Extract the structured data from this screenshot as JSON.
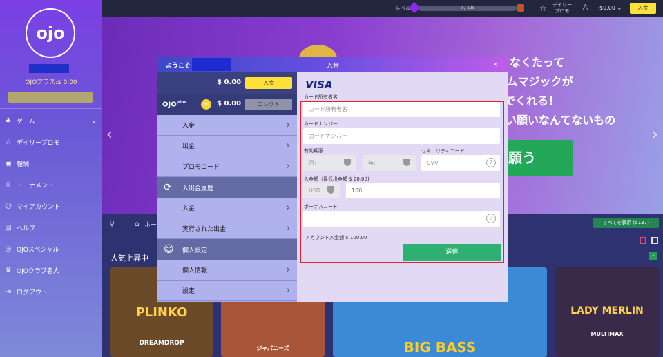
{
  "sidebar": {
    "logo": "ojo",
    "ojo_plus": "OJOプラス:$ 0.00",
    "button_label": "",
    "items": [
      {
        "label": "ゲーム",
        "icon": "game-icon",
        "chevron": "⌄"
      },
      {
        "label": "デイリープロモ",
        "icon": "star-icon"
      },
      {
        "label": "報酬",
        "icon": "reward-icon"
      },
      {
        "label": "トーナメント",
        "icon": "trophy-icon"
      },
      {
        "label": "マイアカウント",
        "icon": "user-icon"
      },
      {
        "label": "ヘルプ",
        "icon": "help-icon"
      },
      {
        "label": "OJOスペシャル",
        "icon": "ojo-special-icon"
      },
      {
        "label": "OJOクラブ名人",
        "icon": "crown-icon"
      },
      {
        "label": "ログアウト",
        "icon": "logout-icon"
      }
    ]
  },
  "topbar": {
    "level_label": "レベル",
    "level_progress": "0 / 125",
    "promo_label": "デイリー\nプロモ",
    "balance": "$0.00",
    "deposit_label": "入金"
  },
  "banner": {
    "line1": "なくたって",
    "line2": "ームマジックが",
    "line3": "でくれる！",
    "line4": "い願いなんてないもの",
    "cta": "願う"
  },
  "lower": {
    "home_label": "ホー",
    "show_all": "すべてを表示 (5137)",
    "section_title": "人気上昇中",
    "tiles": [
      {
        "title": "PLINKO",
        "subtitle": "DREAMDROP"
      },
      {
        "title": "ジャパニーズ"
      },
      {
        "title": "BIG BASS"
      },
      {
        "title": "LADY MERLIN",
        "subtitle": "MULTIMAX"
      }
    ]
  },
  "modal": {
    "welcome": "ようこそ",
    "title": "入金",
    "balance": "$ 0.00",
    "deposit_btn": "入金",
    "ojoplus_logo": "OJO",
    "ojoplus_sup": "plus",
    "ojoplus_balance": "$ 0.00",
    "collect_btn": "コレクト",
    "menu": [
      {
        "label": "入金",
        "type": "row"
      },
      {
        "label": "出金",
        "type": "row"
      },
      {
        "label": "プロモコード",
        "type": "row"
      },
      {
        "label": "入出金履歴",
        "type": "head"
      },
      {
        "label": "入金",
        "type": "row"
      },
      {
        "label": "実行された出金",
        "type": "row"
      },
      {
        "label": "個人設定",
        "type": "head"
      },
      {
        "label": "個人情報",
        "type": "row"
      },
      {
        "label": "設定",
        "type": "row"
      }
    ],
    "form": {
      "card_brand": "VISA",
      "cardholder_label": "カード所有者名",
      "cardholder_placeholder": "カード所有者名",
      "cardnumber_label": "カードナンバー",
      "cardnumber_placeholder": "カードナンバー",
      "expiry_label": "有効期限",
      "month_placeholder": "月:",
      "year_placeholder": "年:",
      "security_label": "セキュリティコード",
      "cvv_placeholder": "CVV",
      "amount_label": "入金額（最低出金額 $ 20.00)",
      "currency": "USD",
      "amount_value": "100",
      "bonus_label": "ボーナスコード",
      "account_min": "アカウント入金額  $ 100.00",
      "submit": "送信"
    }
  }
}
